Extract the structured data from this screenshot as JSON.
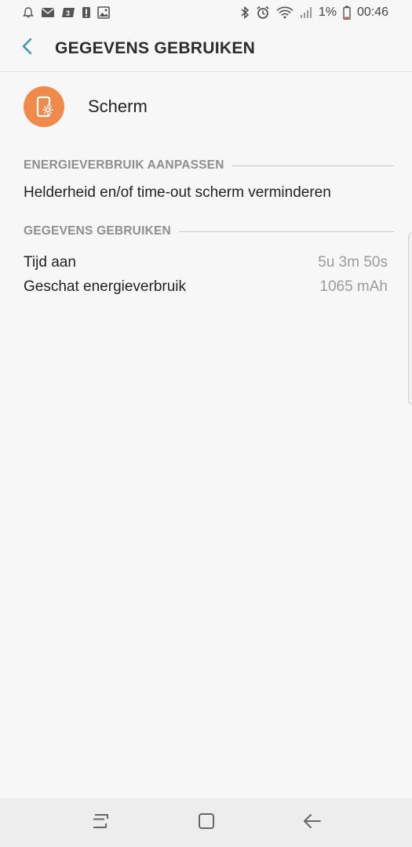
{
  "status_bar": {
    "battery_text": "1%",
    "time": "00:46",
    "left_icons": [
      "notification-bell-icon",
      "mail-icon",
      "sim-3-icon",
      "alert-icon",
      "image-icon"
    ],
    "right_icons": [
      "bluetooth-icon",
      "alarm-icon",
      "wifi-icon",
      "signal-icon",
      "battery-icon"
    ]
  },
  "header": {
    "back_icon": "chevron-left-icon",
    "title": "GEGEVENS GEBRUIKEN"
  },
  "app": {
    "name": "Scherm",
    "icon": "screen-brightness-icon",
    "icon_color": "#f08a4b"
  },
  "sections": {
    "adjust": {
      "header": "ENERGIEVERBRUIK AANPASSEN",
      "item": "Helderheid en/of time-out scherm verminderen"
    },
    "usage": {
      "header": "GEGEVENS GEBRUIKEN",
      "rows": [
        {
          "label": "Tijd aan",
          "value": "5u 3m 50s"
        },
        {
          "label": "Geschat energieverbruik",
          "value": "1065 mAh"
        }
      ]
    }
  },
  "nav": {
    "recent": "recent-apps-icon",
    "home": "home-icon",
    "back": "back-arrow-icon"
  },
  "colors": {
    "accent": "#2f97b5",
    "background": "#f7f7f7",
    "section_header": "#8e8e8e",
    "value_text": "#9a9a9a"
  }
}
